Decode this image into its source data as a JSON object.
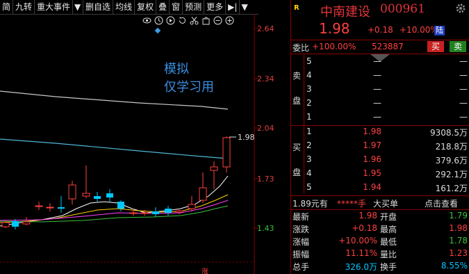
{
  "toolbar": {
    "items": [
      "简",
      "九转",
      "重大事件",
      "▼",
      "删自选",
      "均线",
      "复权",
      "叠",
      "窗",
      "预测",
      "更多",
      "▶|",
      "▼"
    ]
  },
  "watermark": {
    "line1": "模拟",
    "line2": "仅学习用"
  },
  "chart_data": {
    "type": "candlestick",
    "y_ticks": [
      "2.64",
      "2.34",
      "2.04",
      "1.73",
      "1.43"
    ],
    "last_price_label": "1.98",
    "bottom_marker": "涨"
  },
  "stock": {
    "letter": "R",
    "name": "中南建设",
    "code": "000961",
    "price": "1.98",
    "change": "+0.18",
    "change_pct": "+10.00%",
    "exchange_tag": "陆"
  },
  "weibi": {
    "label": "委比",
    "pct": "+100.00%",
    "value": "523887",
    "buy": "买",
    "sell": "卖"
  },
  "sell_side_label": {
    "a": "卖",
    "b": "盘"
  },
  "buy_side_label": {
    "a": "买",
    "b": "盘"
  },
  "sell_levels": [
    {
      "idx": "5",
      "price": "—",
      "vol": "—"
    },
    {
      "idx": "4",
      "price": "—",
      "vol": "—"
    },
    {
      "idx": "3",
      "price": "—",
      "vol": "—"
    },
    {
      "idx": "2",
      "price": "—",
      "vol": "—"
    },
    {
      "idx": "1",
      "price": "—",
      "vol": "—"
    }
  ],
  "buy_levels": [
    {
      "idx": "1",
      "price": "1.98",
      "vol": "9308.5万"
    },
    {
      "idx": "2",
      "price": "1.97",
      "vol": "218.8万"
    },
    {
      "idx": "3",
      "price": "1.96",
      "vol": "379.6万"
    },
    {
      "idx": "4",
      "price": "1.95",
      "vol": "292.1万"
    },
    {
      "idx": "5",
      "price": "1.94",
      "vol": "161.2万"
    }
  ],
  "trade_info": {
    "price": "1.89元有",
    "stars": "*****手",
    "big": "大买单",
    "click": "点击查看"
  },
  "stats": [
    {
      "l1": "最新",
      "v1": "1.98",
      "l2": "开盘",
      "v2": "1.79"
    },
    {
      "l1": "涨跌",
      "v1": "+0.18",
      "l2": "最高",
      "v2": "1.98"
    },
    {
      "l1": "涨幅",
      "v1": "+10.00%",
      "l2": "最低",
      "v2": "1.78"
    },
    {
      "l1": "振幅",
      "v1": "11.11%",
      "l2": "量比",
      "v2": "1.23"
    },
    {
      "l1": "总手",
      "v1": "326.0万",
      "l2": "换手",
      "v2": "8.55%"
    }
  ],
  "colors": {
    "up": "#ff4040",
    "down": "#39c439",
    "cyan": "#00c8ff",
    "axis": "#8b0000",
    "ma5": "#ffffff",
    "ma10": "#ffd200",
    "ma20": "#ff40ff",
    "ma60": "#39c439"
  }
}
